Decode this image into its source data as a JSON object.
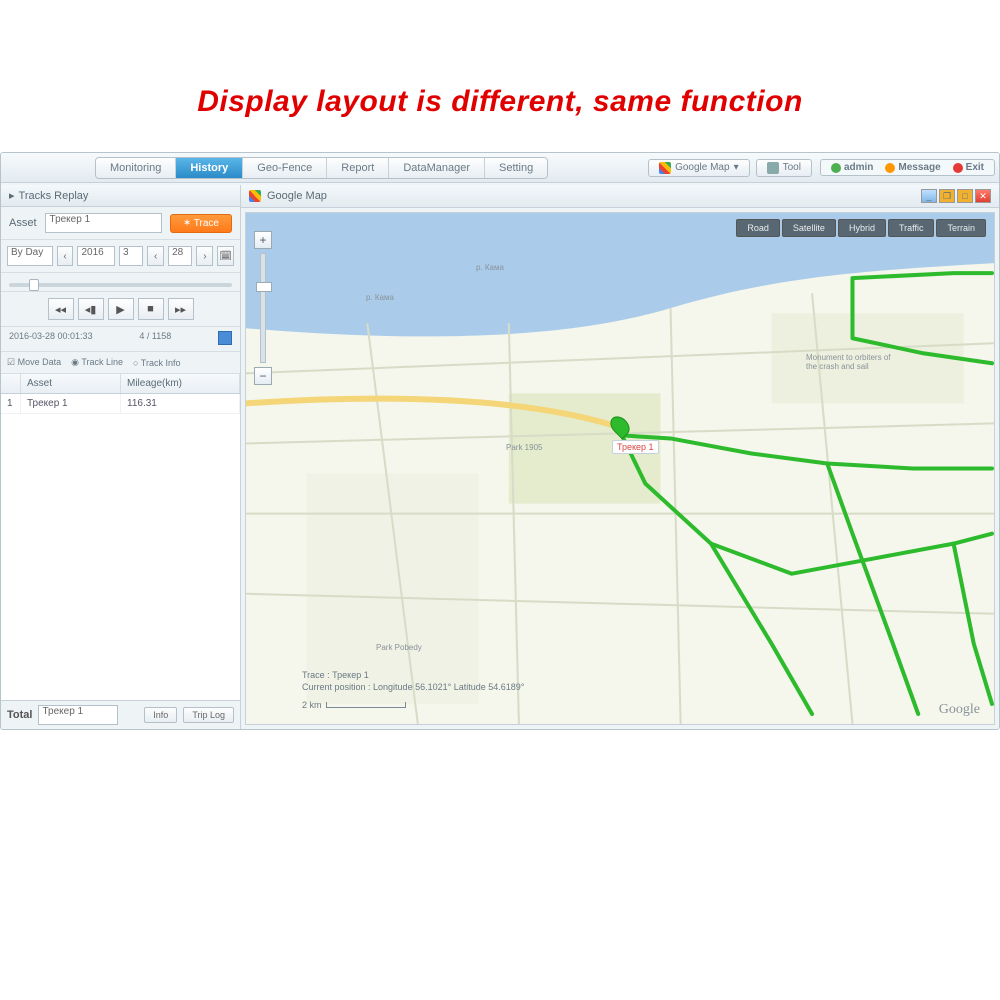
{
  "headline": "Display layout is different, same function",
  "tabs": [
    "Monitoring",
    "History",
    "Geo-Fence",
    "Report",
    "DataManager",
    "Setting"
  ],
  "active_tab_index": 1,
  "top_map_select": "Google Map",
  "top_tool": "Tool",
  "user_strip": {
    "user": "admin",
    "msg": "Message",
    "exit": "Exit"
  },
  "sidebar": {
    "panel_title": "Tracks Replay",
    "asset_lbl": "Asset",
    "asset_value": "Трекер 1",
    "run_btn": "Trace",
    "range": "By Day",
    "year": "2016",
    "month": "3",
    "day": "28",
    "timestamp": "2016-03-28 00:01:33",
    "progress": "4 / 1158",
    "opt_mdata": "Move Data",
    "opt_tline": "Track Line",
    "opt_tinfo": "Track Info",
    "th1": "Asset",
    "th2": "Mileage(km)",
    "row_asset": "Трекер 1",
    "row_mileage": "116.31",
    "footer_lbl": "Total",
    "footer_sel": "Трекер 1",
    "footer_b1": "Info",
    "footer_b2": "Trip Log"
  },
  "map": {
    "title": "Google Map",
    "types": [
      "Road",
      "Satellite",
      "Hybrid",
      "Traffic",
      "Terrain"
    ],
    "trace_l1": "Trace : Трекер 1",
    "trace_l2": "Current position : Longitude 56.1021° Latitude 54.6189°",
    "scale": "2 km",
    "marker_label": "Трекер 1",
    "logo": "Google"
  }
}
